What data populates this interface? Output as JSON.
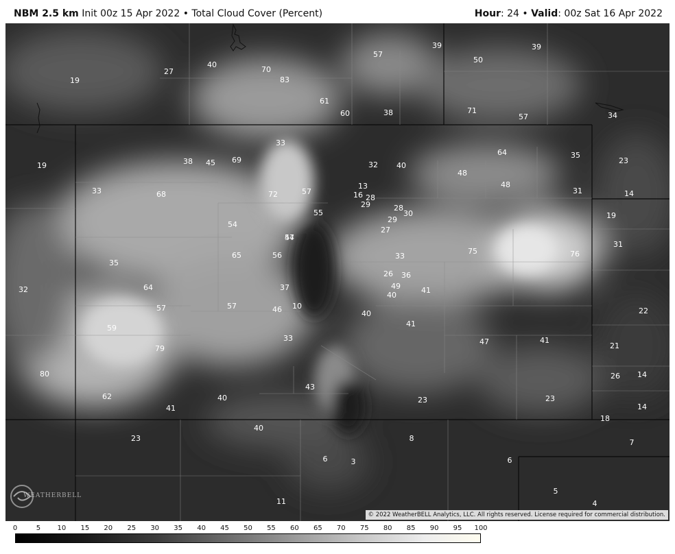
{
  "header": {
    "model": "NBM 2.5 km",
    "init": "Init 00z 15 Apr 2022",
    "bullet": "•",
    "field": "Total Cloud Cover (Percent)",
    "hour_label": "Hour",
    "hour_value": ": 24",
    "valid_label": "Valid",
    "valid_value": ": 00z Sat 16 Apr 2022"
  },
  "copyright": "© 2022 WeatherBELL Analytics, LLC. All rights reserved. License required for commercial distribution.",
  "logo_text": "WEATHERBELL",
  "colorbar": {
    "ticks": [
      "0",
      "5",
      "10",
      "15",
      "20",
      "25",
      "30",
      "35",
      "40",
      "45",
      "50",
      "55",
      "60",
      "65",
      "70",
      "75",
      "80",
      "85",
      "90",
      "95",
      "100"
    ]
  },
  "values": [
    "19",
    "27",
    "40",
    "70",
    "83",
    "61",
    "60",
    "38",
    "57",
    "39",
    "50",
    "39",
    "71",
    "57",
    "34",
    "19",
    "33",
    "38",
    "45",
    "69",
    "33",
    "32",
    "40",
    "64",
    "35",
    "23",
    "48",
    "48",
    "31",
    "14",
    "68",
    "72",
    "57",
    "13",
    "16",
    "28",
    "29",
    "28",
    "30",
    "55",
    "29",
    "27",
    "54",
    "57",
    "44",
    "65",
    "56",
    "35",
    "75",
    "76",
    "19",
    "31",
    "33",
    "26",
    "36",
    "49",
    "40",
    "41",
    "37",
    "64",
    "32",
    "57",
    "57",
    "46",
    "10",
    "40",
    "41",
    "22",
    "59",
    "33",
    "47",
    "41",
    "21",
    "79",
    "80",
    "26",
    "14",
    "43",
    "62",
    "40",
    "41",
    "23",
    "23",
    "14",
    "18",
    "40",
    "23",
    "8",
    "7",
    "6",
    "3",
    "6",
    "5",
    "11",
    "4"
  ]
}
